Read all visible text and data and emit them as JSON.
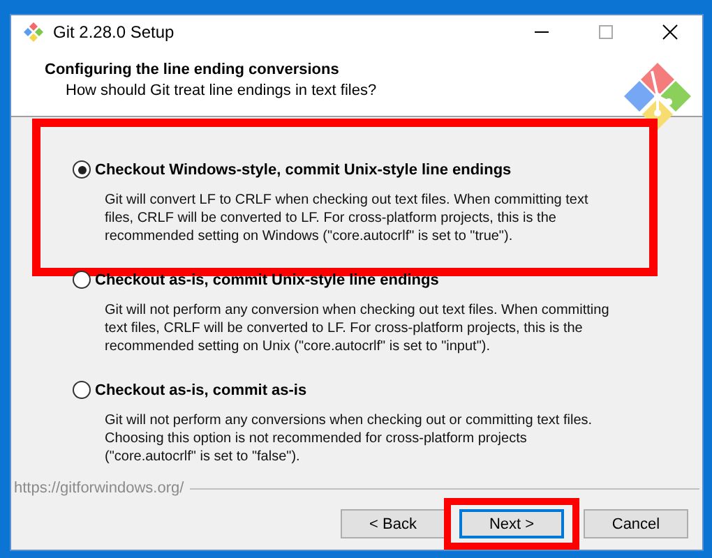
{
  "window": {
    "title": "Git 2.28.0 Setup"
  },
  "header": {
    "title": "Configuring the line ending conversions",
    "subtitle": "How should Git treat line endings in text files?"
  },
  "options": [
    {
      "label": "Checkout Windows-style, commit Unix-style line endings",
      "description": "Git will convert LF to CRLF when checking out text files. When committing text files, CRLF will be converted to LF. For cross-platform projects, this is the recommended setting on Windows (\"core.autocrlf\" is set to \"true\").",
      "selected": true,
      "highlighted": true
    },
    {
      "label": "Checkout as-is, commit Unix-style line endings",
      "description": "Git will not perform any conversion when checking out text files. When committing text files, CRLF will be converted to LF. For cross-platform projects, this is the recommended setting on Unix (\"core.autocrlf\" is set to \"input\").",
      "selected": false,
      "highlighted": false
    },
    {
      "label": "Checkout as-is, commit as-is",
      "description": "Git will not perform any conversions when checking out or committing text files. Choosing this option is not recommended for cross-platform projects (\"core.autocrlf\" is set to \"false\").",
      "selected": false,
      "highlighted": false
    }
  ],
  "footer": {
    "link": "https://gitforwindows.org/"
  },
  "buttons": [
    {
      "label": "< Back",
      "focused": false,
      "highlighted": false
    },
    {
      "label": "Next >",
      "focused": true,
      "highlighted": true
    },
    {
      "label": "Cancel",
      "focused": false,
      "highlighted": false
    }
  ]
}
